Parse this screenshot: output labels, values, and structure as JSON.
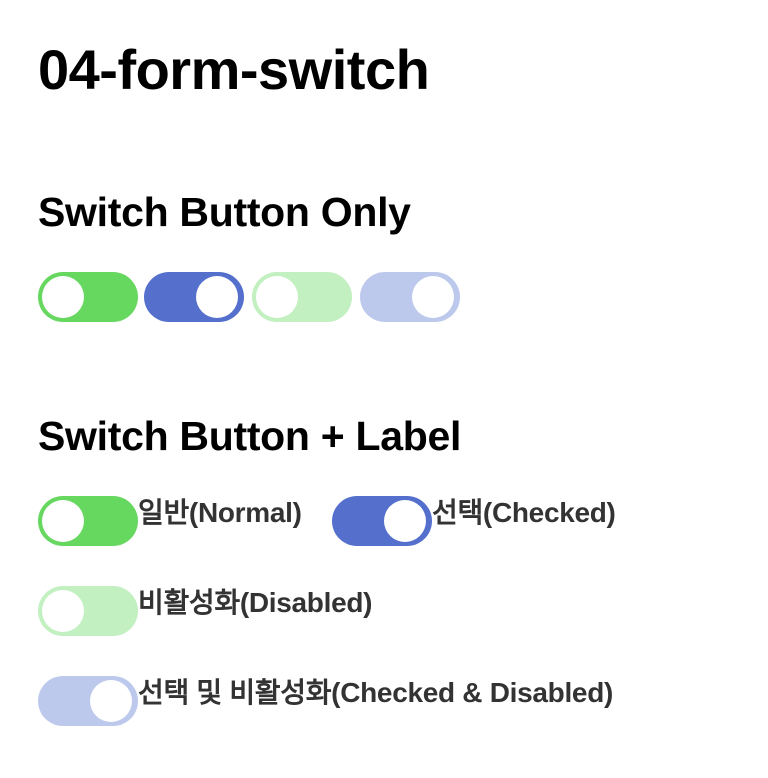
{
  "page": {
    "title": "04-form-switch"
  },
  "section_only": {
    "title": "Switch Button Only",
    "switches": [
      {
        "state": "off",
        "disabled": false,
        "color": "#66d75f"
      },
      {
        "state": "on",
        "disabled": false,
        "color": "#5470cc"
      },
      {
        "state": "off",
        "disabled": true,
        "color": "#c2f0c0"
      },
      {
        "state": "on",
        "disabled": true,
        "color": "#bdc9ec"
      }
    ]
  },
  "section_label": {
    "title": "Switch Button + Label",
    "items": [
      {
        "label": "일반(Normal)",
        "state": "off",
        "disabled": false
      },
      {
        "label": "선택(Checked)",
        "state": "on",
        "disabled": false
      },
      {
        "label": "비활성화(Disabled)",
        "state": "off",
        "disabled": true
      },
      {
        "label": "선택 및 비활성화(Checked & Disabled)",
        "state": "on",
        "disabled": true
      }
    ]
  },
  "colors": {
    "off_color": "#66d75f",
    "on_color": "#5470cc",
    "off_disabled_color": "#c2f0c0",
    "on_disabled_color": "#bdc9ec",
    "knob": "#ffffff",
    "label_text": "#333333"
  }
}
